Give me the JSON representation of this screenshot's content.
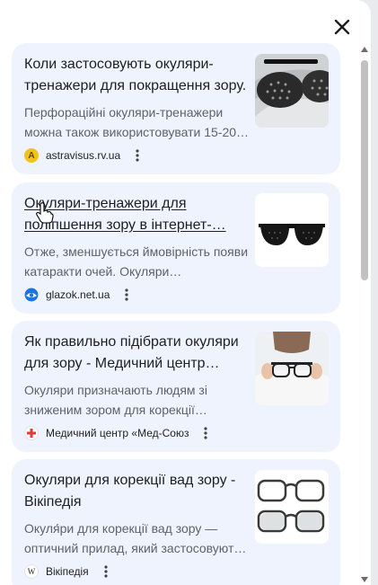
{
  "panel": {
    "close_icon": "close-icon"
  },
  "cards": [
    {
      "title": "Коли застосовують окуляри-тренажери для покращення зору.",
      "snippet": "Перфораційні окуляри-тренажери можна також використовувати 15-20…",
      "source": "astravisus.rv.ua",
      "favicon_letter": "A",
      "favicon_color": "#f2c21b",
      "thumbnail": "pinhole-glasses-photo"
    },
    {
      "title": "Окуляри-тренажери для поліпшення зору в інтернет-…",
      "snippet": "Отже, зменшується ймовірність появи катаракти очей. Окуляри…",
      "source": "glazok.net.ua",
      "favicon_color": "#1a73e8",
      "thumbnail": "pinhole-sunglasses-photo"
    },
    {
      "title": "Як правильно підібрати окуляри для зору - Медичний центр…",
      "snippet": "Окуляри призначають людям зі зниженим зором для корекції…",
      "source": "Медичний центр «Мед-Союз",
      "favicon_color": "#e53935",
      "thumbnail": "woman-holding-glasses-photo"
    },
    {
      "title": "Окуляри для корекції вад зору - Вікіпедія",
      "snippet": "Окуля́ри для корекції вад зору — оптичний прилад, який застосовуют…",
      "source": "Вікіпедія",
      "favicon_letter": "W",
      "favicon_color": "#ffffff",
      "thumbnail": "two-eyeglasses-photo"
    }
  ]
}
